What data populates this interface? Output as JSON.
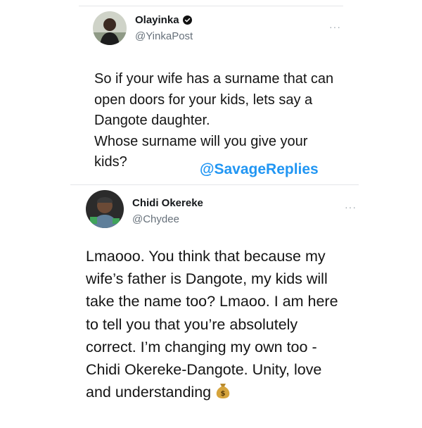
{
  "tweet1": {
    "name": "Olayinka",
    "handle": "@YinkaPost",
    "more": "···",
    "lines": [
      "So if your wife has a surname that can",
      "open doors for your kids, lets say a",
      "Dangote daughter.",
      "Whose surname will you give your",
      "kids?"
    ]
  },
  "watermark": "@SavageReplies",
  "tweet2": {
    "name": "Chidi Okereke",
    "handle": "@Chydee",
    "more": "···",
    "lines": [
      "Lmaooo. You think that because my",
      "wife’s father is Dangote, my kids will",
      "take the name too? Lmaoo. I am here",
      "to tell you that you’re absolutely",
      "correct. I’m changing my own too -",
      "Chidi Okereke-Dangote. Unity, love",
      "and understanding"
    ]
  },
  "icons": {
    "verified": "verified-badge-icon",
    "money": "money-bag-icon",
    "more": "more-options-icon"
  },
  "colors": {
    "watermark": "#2196f3",
    "handle": "#66707a",
    "divider": "#e4e6e8"
  }
}
